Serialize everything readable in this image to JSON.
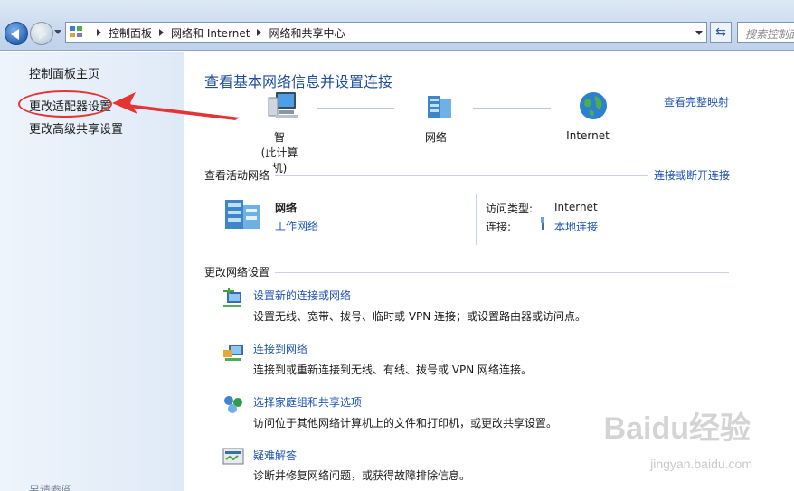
{
  "address_bar": {
    "crumbs": [
      "控制面板",
      "网络和 Internet",
      "网络和共享中心"
    ],
    "search_placeholder": "搜索控制面"
  },
  "left_pane": {
    "items": [
      {
        "label": "控制面板主页"
      },
      {
        "label": "更改适配器设置"
      },
      {
        "label": "更改高级共享设置"
      }
    ],
    "see_also": "另请参阅"
  },
  "main": {
    "heading": "查看基本网络信息并设置连接",
    "full_map": "查看完整映射",
    "map": {
      "computer_name": "智",
      "computer_sub": "(此计算机)",
      "network": "网络",
      "internet": "Internet"
    },
    "active": {
      "title": "查看活动网络",
      "connect_link": "连接或断开连接",
      "network_name": "网络",
      "network_type": "工作网络",
      "access_label": "访问类型:",
      "access_value": "Internet",
      "conn_label": "连接:",
      "conn_value": "本地连接"
    },
    "change": {
      "title": "更改网络设置",
      "tasks": [
        {
          "title": "设置新的连接或网络",
          "desc": "设置无线、宽带、拨号、临时或 VPN 连接；或设置路由器或访问点。"
        },
        {
          "title": "连接到网络",
          "desc": "连接到或重新连接到无线、有线、拨号或 VPN 网络连接。"
        },
        {
          "title": "选择家庭组和共享选项",
          "desc": "访问位于其他网络计算机上的文件和打印机，或更改共享设置。"
        },
        {
          "title": "疑难解答",
          "desc": "诊断并修复网络问题，或获得故障排除信息。"
        }
      ]
    }
  },
  "watermark": {
    "logo": "Baidu经验",
    "url": "jingyan.baidu.com"
  },
  "colors": {
    "link": "#1f55b5",
    "heading": "#1e4e9a",
    "annotation": "#e53434"
  }
}
